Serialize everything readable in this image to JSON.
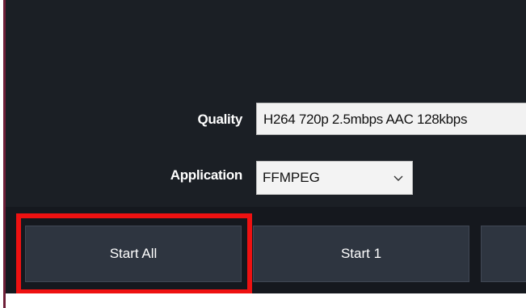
{
  "form": {
    "quality_label": "Quality",
    "quality_value": "H264 720p 2.5mbps AAC 128kbps",
    "application_label": "Application",
    "application_value": "FFMPEG"
  },
  "actions": {
    "start_all_label": "Start All",
    "start_1_label": "Start 1",
    "next_button_label": ""
  },
  "icons": {
    "dropdown": "chevron-down-icon"
  },
  "colors": {
    "panel_bg": "#1b1f25",
    "button_bg": "#2e3540",
    "highlight": "#ee1111",
    "accent_edge": "#6e1f38"
  }
}
